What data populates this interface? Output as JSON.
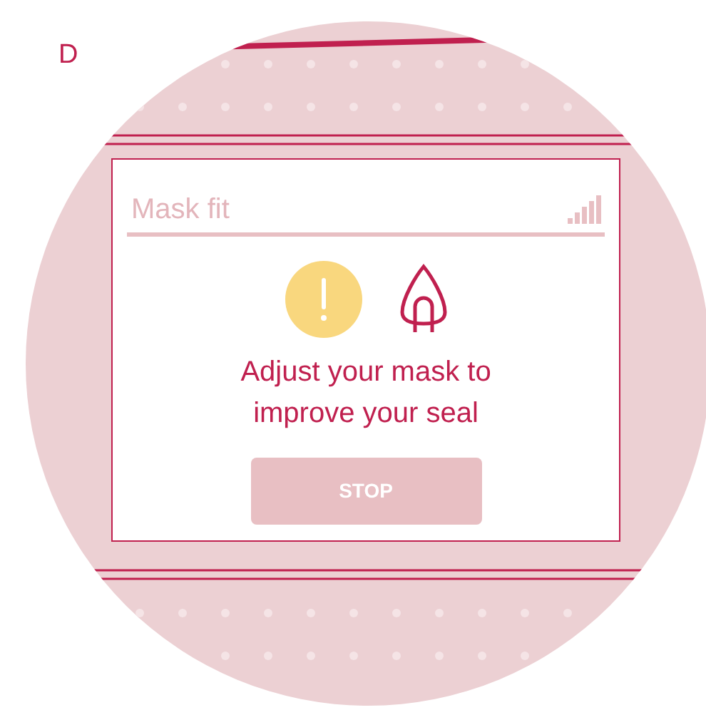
{
  "figure_label": "D",
  "screen": {
    "title": "Mask fit",
    "alert": {
      "kind": "warning",
      "message": "Adjust your mask to improve your seal"
    },
    "button": "STOP"
  }
}
